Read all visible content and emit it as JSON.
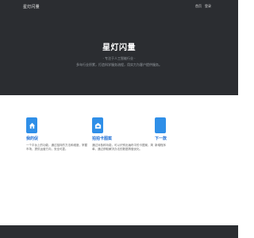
{
  "header": {
    "brand": "星灯闪量",
    "nav": [
      "首页",
      "登录"
    ]
  },
  "hero": {
    "title": "星灯闪量",
    "subtitle": "· 专注于人工智能行业 ·",
    "description": "多年行业积累，打造科学服务流程，用实力为客户提供服务。"
  },
  "features": [
    {
      "icon": "home-icon",
      "title": "我的促",
      "desc": "一个平台上的功能，通过独特的方法和维度，掌握市场，提供运营方向，安全可靠。"
    },
    {
      "icon": "house-icon",
      "title": "拍拍卡图案",
      "desc": "通过对各种功能，可以识别出遍布中的卡图案，简单。通过获取解决办法的数据再做优化。"
    },
    {
      "icon": "phone-icon",
      "title": "下一款",
      "desc": "新增程序"
    }
  ],
  "colors": {
    "dark": "#2b2d31",
    "accent": "#2f8fe8",
    "title": "#1f6ed4"
  }
}
